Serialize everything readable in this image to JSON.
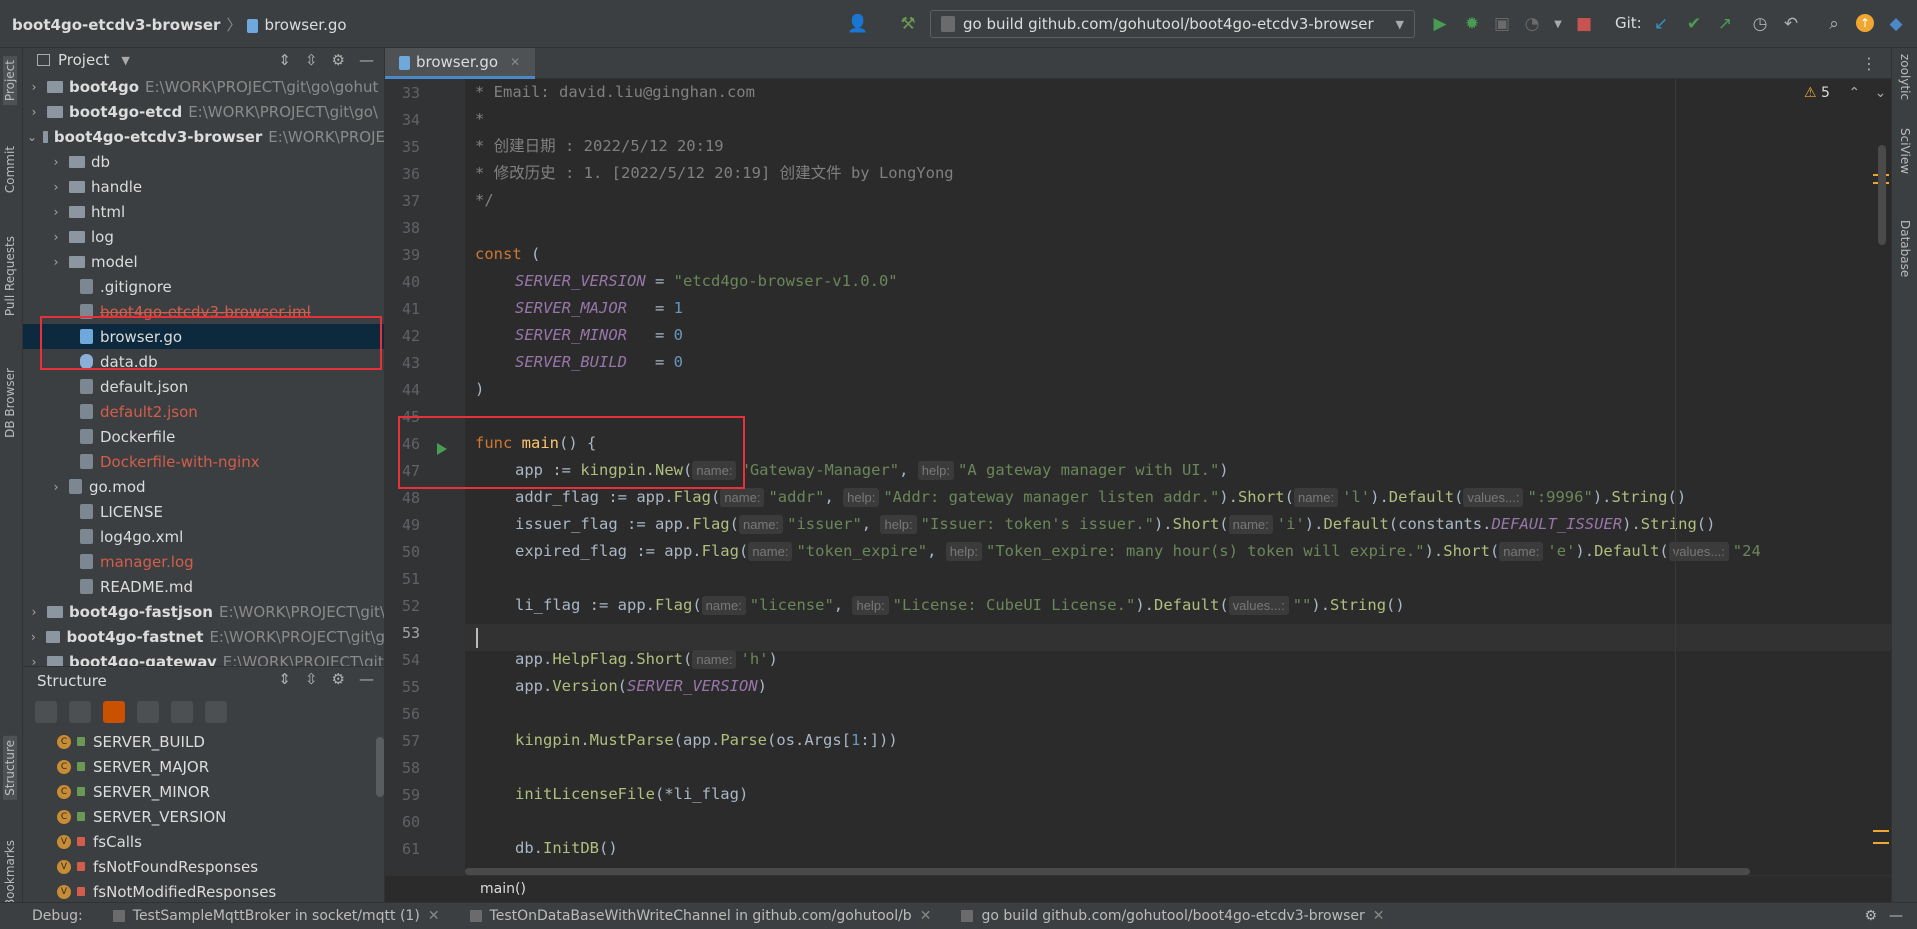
{
  "breadcrumb": {
    "project": "boot4go-etcdv3-browser",
    "file": "browser.go"
  },
  "run_config": "go build github.com/gohutool/boot4go-etcdv3-browser",
  "git_label": "Git:",
  "left_tools": [
    "Project",
    "Commit",
    "Pull Requests",
    "DB Browser",
    "Structure",
    "Bookmarks"
  ],
  "right_tools": [
    "zoolytic",
    "SciView",
    "Database"
  ],
  "project_panel": {
    "title": "Project",
    "items": [
      {
        "label": "boot4go",
        "path": "E:\\WORK\\PROJECT\\git\\go\\gohut"
      },
      {
        "label": "boot4go-etcd",
        "path": "E:\\WORK\\PROJECT\\git\\go\\"
      },
      {
        "label": "boot4go-etcdv3-browser",
        "path": "E:\\WORK\\PROJE"
      },
      {
        "label": "db"
      },
      {
        "label": "handle"
      },
      {
        "label": "html"
      },
      {
        "label": "log"
      },
      {
        "label": "model"
      },
      {
        "label": ".gitignore"
      },
      {
        "label": "boot4go-etcdv3-browser.iml"
      },
      {
        "label": "browser.go"
      },
      {
        "label": "data.db"
      },
      {
        "label": "default.json"
      },
      {
        "label": "default2.json"
      },
      {
        "label": "Dockerfile"
      },
      {
        "label": "Dockerfile-with-nginx"
      },
      {
        "label": "go.mod"
      },
      {
        "label": "LICENSE"
      },
      {
        "label": "log4go.xml"
      },
      {
        "label": "manager.log"
      },
      {
        "label": "README.md"
      },
      {
        "label": "boot4go-fastjson",
        "path": "E:\\WORK\\PROJECT\\git\\"
      },
      {
        "label": "boot4go-fastnet",
        "path": "E:\\WORK\\PROJECT\\git\\g"
      },
      {
        "label": "boot4go-gateway",
        "path": "E:\\WORK\\PROJECT\\git"
      }
    ]
  },
  "structure_panel": {
    "title": "Structure",
    "items": [
      {
        "label": "SERVER_BUILD",
        "badge": "C"
      },
      {
        "label": "SERVER_MAJOR",
        "badge": "C"
      },
      {
        "label": "SERVER_MINOR",
        "badge": "C"
      },
      {
        "label": "SERVER_VERSION",
        "badge": "C"
      },
      {
        "label": "fsCalls",
        "badge": "V"
      },
      {
        "label": "fsNotFoundResponses",
        "badge": "V"
      },
      {
        "label": "fsNotModifiedResponses",
        "badge": "V"
      }
    ]
  },
  "editor": {
    "tab": "browser.go",
    "warnings": "5",
    "line_numbers": [
      "33",
      "34",
      "35",
      "36",
      "37",
      "38",
      "39",
      "40",
      "41",
      "42",
      "43",
      "44",
      "45",
      "46",
      "47",
      "48",
      "49",
      "50",
      "51",
      "52",
      "53",
      "54",
      "55",
      "56",
      "57",
      "58",
      "59",
      "60",
      "61"
    ],
    "hints": {
      "name": "name:",
      "help": "help:",
      "values": "values...:"
    },
    "text": {
      "l33": "* Email: david.liu@ginghan.com",
      "l34": "*",
      "l35": "* 创建日期 : 2022/5/12 20:19",
      "l36": "* 修改历史 : 1. [2022/5/12 20:19] 创建文件 by LongYong",
      "l37": "*/",
      "kw_const": "const",
      "paren_open": " (",
      "paren_close": ")",
      "SERVER_VERSION": "SERVER_VERSION",
      "SERVER_MAJOR": "SERVER_MAJOR",
      "SERVER_MINOR": "SERVER_MINOR",
      "SERVER_BUILD": "SERVER_BUILD",
      "eq1": " = ",
      "eq2": "   = ",
      "eq3": "   = ",
      "eq4": "   = ",
      "v_version": "\"etcd4go-browser-v1.0.0\"",
      "v_major": "1",
      "v_minor": "0",
      "v_build": "0",
      "kw_func": "func",
      "fn_main": " main",
      "main_rest": "() {",
      "l47_a": "app := ",
      "kingpin": "kingpin",
      "dot_new": ".",
      "New": "New",
      "open": "(",
      "s_gw": "\"Gateway-Manager\"",
      "comma": ", ",
      "s_gw_help": "\"A gateway manager with UI.\"",
      "close": ")",
      "l48_a": "addr_flag := app.",
      "Flag": "Flag",
      "s_addr": "\"addr\"",
      "s_addr_help": "\"Addr: gateway manager listen addr.\"",
      "close_dot": ").",
      "Short": "Short",
      "s_l": "'l'",
      "Default": "Default",
      "s_port": "\":9996\"",
      "String": "String",
      "call_end": "()",
      "l49_a": "issuer_flag := app.",
      "s_issuer": "\"issuer\"",
      "s_issuer_help": "\"Issuer: token's issuer.\"",
      "s_i": "'i'",
      "constants": "constants",
      "dot": ".",
      "DEFAULT_ISSUER": "DEFAULT_ISSUER",
      "l50_a": "expired_flag := app.",
      "s_expire": "\"token_expire\"",
      "s_expire_help": "\"Token_expire: many hour(s) token will expire.\"",
      "s_e": "'e'",
      "s_24": "\"24",
      "l52_a": "li_flag := app.",
      "s_license": "\"license\"",
      "s_license_help": "\"License: CubeUI License.\"",
      "s_empty": "\"\"",
      "l54_a": "app.",
      "HelpFlag": "HelpFlag",
      "s_h": "'h'",
      "l55_a": "app.",
      "Version": "Version",
      "l57_b": "MustParse",
      "l57_c": "(app.",
      "Parse": "Parse",
      "l57_d": "(os.Args[",
      "one": "1",
      "l57_e": ":]))",
      "l59_a": "initLicenseFile",
      "l59_b": "(*li_flag)",
      "l61_a": "db.",
      "InitDB": "InitDB"
    }
  },
  "status_crumb": "main()",
  "debug_bar": {
    "label": "Debug:",
    "tabs": [
      "TestSampleMqttBroker in socket/mqtt (1)",
      "TestOnDataBaseWithWriteChannel in github.com/gohutool/b",
      "go build github.com/gohutool/boot4go-etcdv3-browser"
    ]
  },
  "colors": {
    "accent": "#4a88c7",
    "run_green": "#499c54",
    "highlight_box": "#e8303a",
    "selection": "#0d293e"
  }
}
